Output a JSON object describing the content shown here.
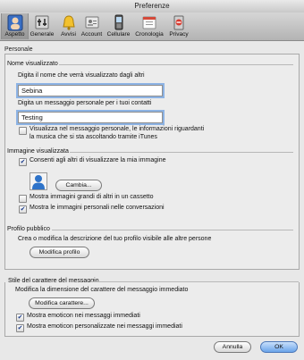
{
  "window": {
    "title": "Preferenze"
  },
  "toolbar": {
    "items": [
      {
        "label": "Aspetto",
        "icon": "appearance-icon",
        "selected": true
      },
      {
        "label": "Generale",
        "icon": "general-icon"
      },
      {
        "label": "Avvisi",
        "icon": "alerts-bell-icon"
      },
      {
        "label": "Account",
        "icon": "account-icon"
      },
      {
        "label": "Cellulare",
        "icon": "mobile-phone-icon"
      },
      {
        "label": "Cronologia",
        "icon": "history-icon"
      },
      {
        "label": "Privacy",
        "icon": "privacy-icon"
      }
    ]
  },
  "tab_header": "Personale",
  "nome": {
    "group_title": "Nome visualizzato",
    "name_prompt": "Digita il nome che verrà visualizzato dagli altri",
    "name_value": "Sebina",
    "message_prompt": "Digita un messaggio personale per i tuoi contatti",
    "message_value": "Testing",
    "itunes_label_line1": "Visualizza nel messaggio personale, le informazioni riguardanti",
    "itunes_label_line2": "la musica che si sta ascoltando tramite iTunes",
    "itunes_checked": false
  },
  "immagine": {
    "group_title": "Immagine visualizzata",
    "allow_label": "Consenti agli altri di visualizzare la mia immagine",
    "allow_checked": true,
    "change_button": "Cambia...",
    "large_label": "Mostra immagini grandi di altri in un cassetto",
    "large_checked": false,
    "show_label": "Mostra le immagini personali nelle conversazioni",
    "show_checked": true
  },
  "profilo": {
    "group_title": "Profilo pubblico",
    "description": "Crea o modifica la descrizione del tuo profilo visibile alle altre persone",
    "button": "Modifica profilo"
  },
  "stile": {
    "group_title": "Stile del carattere del messaggio",
    "description": "Modifica la dimensione del carattere del messaggio immediato",
    "button": "Modifica carattere...",
    "emoticon_label": "Mostra emoticon nei messaggi immediati",
    "emoticon_checked": true,
    "custom_emoticon_label": "Mostra emoticon personalizzate nei messaggi immediati",
    "custom_emoticon_checked": true
  },
  "footer": {
    "cancel": "Annulla",
    "ok": "OK"
  },
  "check_glyph": "✔"
}
